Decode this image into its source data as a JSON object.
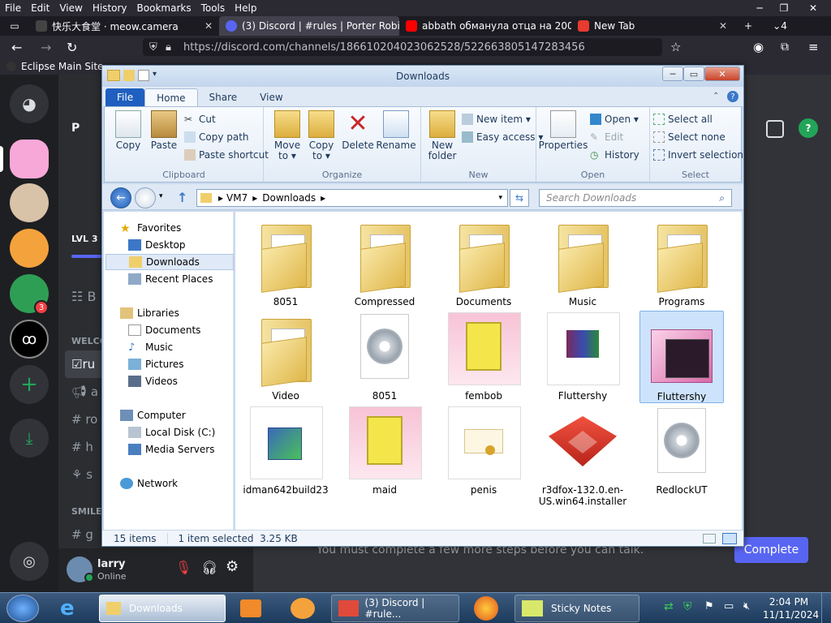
{
  "firefox": {
    "menu": [
      "File",
      "Edit",
      "View",
      "History",
      "Bookmarks",
      "Tools",
      "Help"
    ],
    "tabs": [
      {
        "label": "快乐大食堂 · meow.camera",
        "color": "#444444"
      },
      {
        "label": "(3) Discord | #rules | Porter Robi",
        "color": "#5865f2"
      },
      {
        "label": "abbath обманула отца на 200 (",
        "color": "#ff0000"
      },
      {
        "label": "New Tab",
        "color": "#e63b2e"
      }
    ],
    "tab_count": "4",
    "url": "https://discord.com/channels/186610204023062528/522663805147283456",
    "bookmark": "Eclipse Main Site"
  },
  "discord": {
    "badge": "3",
    "channel_title": "P",
    "level": "LVL 3",
    "section_welcome": "WELCO",
    "section_smile": "SMILE",
    "channels": [
      "B",
      "ru",
      "a",
      "ro",
      "h",
      "s",
      "g"
    ],
    "user_name": "larry",
    "user_status": "Online",
    "complete": "Complete",
    "talk_message": "You must complete a few more steps before you can talk."
  },
  "explorer": {
    "title": "Downloads",
    "ribbon_tabs": [
      "File",
      "Home",
      "Share",
      "View"
    ],
    "clipboard": {
      "copy": "Copy",
      "paste": "Paste",
      "cut": "Cut",
      "copy_path": "Copy path",
      "paste_shortcut": "Paste shortcut",
      "label": "Clipboard"
    },
    "organize": {
      "move": "Move",
      "move2": "to ▾",
      "copy": "Copy",
      "copy2": "to ▾",
      "delete": "Delete",
      "rename": "Rename",
      "label": "Organize"
    },
    "new": {
      "folder": "New",
      "folder2": "folder",
      "item": "New item ▾",
      "easy": "Easy access ▾",
      "label": "New"
    },
    "open": {
      "properties": "Properties",
      "open": "Open ▾",
      "edit": "Edit",
      "history": "History",
      "label": "Open"
    },
    "select": {
      "all": "Select all",
      "none": "Select none",
      "invert": "Invert selection",
      "label": "Select"
    },
    "breadcrumb": [
      "VM7",
      "Downloads"
    ],
    "search_placeholder": "Search Downloads",
    "nav": {
      "favorites": "Favorites",
      "desktop": "Desktop",
      "downloads": "Downloads",
      "recent": "Recent Places",
      "libraries": "Libraries",
      "documents": "Documents",
      "music": "Music",
      "pictures": "Pictures",
      "videos": "Videos",
      "computer": "Computer",
      "localdisk": "Local Disk (C:)",
      "media": "Media Servers",
      "network": "Network"
    },
    "files": [
      {
        "name": "8051",
        "kind": "folder"
      },
      {
        "name": "Compressed",
        "kind": "folder"
      },
      {
        "name": "Documents",
        "kind": "folder"
      },
      {
        "name": "Music",
        "kind": "folder"
      },
      {
        "name": "Programs",
        "kind": "folder"
      },
      {
        "name": "Video",
        "kind": "folder"
      },
      {
        "name": "8051",
        "kind": "disc"
      },
      {
        "name": "fembob",
        "kind": "image"
      },
      {
        "name": "Fluttershy",
        "kind": "rar"
      },
      {
        "name": "Fluttershy",
        "kind": "theme"
      },
      {
        "name": "idman642build23",
        "kind": "installer"
      },
      {
        "name": "maid",
        "kind": "image"
      },
      {
        "name": "penis",
        "kind": "cert"
      },
      {
        "name": "r3dfox-132.0.en-US.win64.installer",
        "kind": "fox"
      },
      {
        "name": "RedlockUT",
        "kind": "disc"
      }
    ],
    "status_items": "15 items",
    "status_selected": "1 item selected  3.25 KB"
  },
  "taskbar": {
    "downloads": "Downloads",
    "discord": "(3) Discord | #rule...",
    "sticky": "Sticky Notes",
    "time": "2:04 PM",
    "date": "11/11/2024"
  }
}
